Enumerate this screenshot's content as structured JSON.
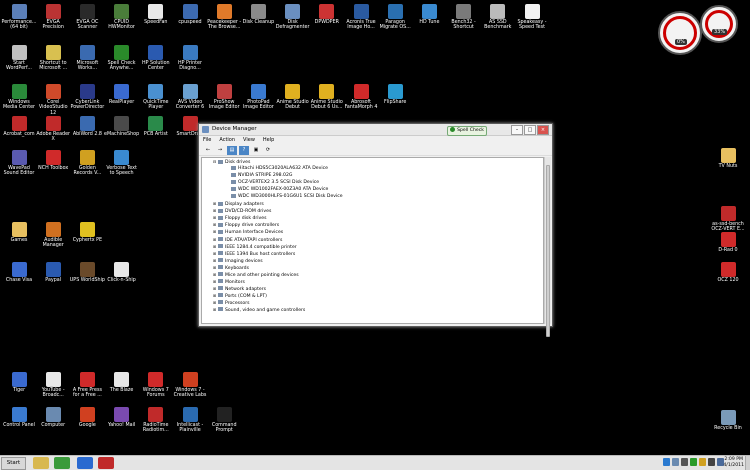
{
  "desktop": {
    "icons": [
      {
        "label": "Performance... (64 bit)",
        "color": "#5b7fb8"
      },
      {
        "label": "EVGA Precision",
        "color": "#b33"
      },
      {
        "label": "EVGA OC Scanner",
        "color": "#2a2a2a"
      },
      {
        "label": "CPUID HWMonitor",
        "color": "#4a7d3a"
      },
      {
        "label": "SpeedFan",
        "color": "#e8e8e8"
      },
      {
        "label": "cpuspeed",
        "color": "#3c6ab0"
      },
      {
        "label": "Peacekeeper - The Browse...",
        "color": "#e07a2a"
      },
      {
        "label": "Disk Cleanup",
        "color": "#8a8a8a"
      },
      {
        "label": "Disk Defragmenter",
        "color": "#6a8fc0"
      },
      {
        "label": "DPWDPER",
        "color": "#c33"
      },
      {
        "label": "Acronis True Image Ho...",
        "color": "#2a5aa0"
      },
      {
        "label": "Paragon Migrate OS...",
        "color": "#2a6fb0"
      },
      {
        "label": "HD Tune",
        "color": "#3a8ad0"
      },
      {
        "label": "Bench32 - Shortcut",
        "color": "#7a7a7a"
      },
      {
        "label": "AS SSD Benchmark",
        "color": "#bbb"
      },
      {
        "label": "Speakeasy - Speed Test",
        "color": "#f2f2f2"
      },
      {
        "label": "Start WordPerf...",
        "color": "#c0c0c0"
      },
      {
        "label": "Shortcut to Microsoft ...",
        "color": "#d8c050"
      },
      {
        "label": "Microsoft Works...",
        "color": "#3a6ab0"
      },
      {
        "label": "Spell Check Anywhe...",
        "color": "#2a8a2a"
      },
      {
        "label": "HP Solution Center",
        "color": "#2a5ab0"
      },
      {
        "label": "HP Printer Diagno...",
        "color": "#3a7ac0"
      },
      {
        "label": "Windows Media Center",
        "color": "#2a8a3a"
      },
      {
        "label": "Corel VideoStudio 12",
        "color": "#d04a2a"
      },
      {
        "label": "CyberLink PowerDirector",
        "color": "#2a3a8a"
      },
      {
        "label": "RealPlayer",
        "color": "#3a6ad0"
      },
      {
        "label": "QuickTime Player",
        "color": "#4a90d0"
      },
      {
        "label": "AVS Video Converter 6",
        "color": "#6aa0d0"
      },
      {
        "label": "ProShow Image Editor",
        "color": "#c04040"
      },
      {
        "label": "PhotoPad Image Editor",
        "color": "#3a7ad0"
      },
      {
        "label": "Anime Studio Debut",
        "color": "#e0b020"
      },
      {
        "label": "Anime Studio Debut 6 Us...",
        "color": "#e0b020"
      },
      {
        "label": "Abrosoft FantaMorph 4",
        "color": "#d02a2a"
      },
      {
        "label": "FlipShare",
        "color": "#2a9ad0"
      },
      {
        "label": "Acrobat_com",
        "color": "#c02a2a"
      },
      {
        "label": "Adobe Reader X",
        "color": "#c02a2a"
      },
      {
        "label": "AbiWord 2.8",
        "color": "#3a6ab0"
      },
      {
        "label": "eMachineShop",
        "color": "#4a4a4a"
      },
      {
        "label": "PCB Artist",
        "color": "#2a8a4a"
      },
      {
        "label": "SmartDraw",
        "color": "#c02a2a"
      },
      {
        "label": "WavePad Sound Editor",
        "color": "#5a5ab0"
      },
      {
        "label": "NCH Toolbox",
        "color": "#d02a2a"
      },
      {
        "label": "Golden Records V...",
        "color": "#d0a020"
      },
      {
        "label": "Verbose Text to Speech",
        "color": "#3a8ad0"
      },
      {
        "label": "Games",
        "color": "#e8c060"
      },
      {
        "label": "Audible Manager",
        "color": "#d07020"
      },
      {
        "label": "Cyphertx PE",
        "color": "#e0c020"
      },
      {
        "label": "Chase Visa",
        "color": "#3a6ad0"
      },
      {
        "label": "Paypal",
        "color": "#2a5ab0"
      },
      {
        "label": "UPS WorldShip",
        "color": "#6a4a2a"
      },
      {
        "label": "Click-n-Ship",
        "color": "#e8e8e8"
      },
      {
        "label": "Tiger",
        "color": "#3a6ad0"
      },
      {
        "label": "YouTube - Broadc...",
        "color": "#e8e8e8"
      },
      {
        "label": "A Free Press for a Free ...",
        "color": "#d02a2a"
      },
      {
        "label": "The Blaze",
        "color": "#e8e8e8"
      },
      {
        "label": "Windows 7 Forums",
        "color": "#d02a2a"
      },
      {
        "label": "Windows 7 - Creative Labs",
        "color": "#d04020"
      },
      {
        "label": "Control Panel",
        "color": "#3a7ad0"
      },
      {
        "label": "Computer",
        "color": "#6a8ab0"
      },
      {
        "label": "Google",
        "color": "#d04020"
      },
      {
        "label": "Yahoo! Mail",
        "color": "#7a4ab0"
      },
      {
        "label": "RadioTime Radiotim...",
        "color": "#c02a2a"
      },
      {
        "label": "Intellicast - Plainville",
        "color": "#2a6ab0"
      },
      {
        "label": "Command Prompt",
        "color": "#222"
      },
      {
        "label": "TV Nuts",
        "color": "#e8c060"
      },
      {
        "label": "as-ssd-bench OCZ-VERT E...",
        "color": "#c02a2a"
      },
      {
        "label": "D-Rad 0",
        "color": "#d02a2a"
      },
      {
        "label": "OCZ 120",
        "color": "#d02a2a"
      },
      {
        "label": "Recycle Bin",
        "color": "#7a9ab8"
      }
    ]
  },
  "gadgets": {
    "cpu_meter_value": "0%",
    "ram_meter_value": "33%"
  },
  "spell_check": {
    "label": "Spell Check"
  },
  "device_manager": {
    "title": "Device Manager",
    "menu": [
      "File",
      "Action",
      "View",
      "Help"
    ],
    "toolbar": [
      "←",
      "→",
      "▤",
      "?",
      "▣",
      "⟳"
    ],
    "tree": [
      {
        "kind": "root",
        "expander": "⊟",
        "label": "Disk drives"
      },
      {
        "kind": "child",
        "expander": "",
        "label": "Hitachi HDS5C3020ALA632 ATA Device"
      },
      {
        "kind": "child",
        "expander": "",
        "label": "NVIDIA  STRIPE  298.02G"
      },
      {
        "kind": "child",
        "expander": "",
        "label": "OCZ-VERTEX2 3.5 SCSI Disk Device"
      },
      {
        "kind": "child",
        "expander": "",
        "label": "WDC WD1002FAEX-00Z3A0 ATA Device"
      },
      {
        "kind": "child",
        "expander": "",
        "label": "WDC WD3000HLFS-01G6U1 SCSI Disk Device"
      },
      {
        "kind": "cat",
        "expander": "⊞",
        "label": "Display adapters"
      },
      {
        "kind": "cat",
        "expander": "⊞",
        "label": "DVD/CD-ROM drives"
      },
      {
        "kind": "cat",
        "expander": "⊞",
        "label": "Floppy disk drives"
      },
      {
        "kind": "cat",
        "expander": "⊞",
        "label": "Floppy drive controllers"
      },
      {
        "kind": "cat",
        "expander": "⊞",
        "label": "Human Interface Devices"
      },
      {
        "kind": "cat",
        "expander": "⊞",
        "label": "IDE ATA/ATAPI controllers"
      },
      {
        "kind": "cat",
        "expander": "⊞",
        "label": "IEEE 1284.4 compatible printer"
      },
      {
        "kind": "cat",
        "expander": "⊞",
        "label": "IEEE 1394 Bus host controllers"
      },
      {
        "kind": "cat",
        "expander": "⊞",
        "label": "Imaging devices"
      },
      {
        "kind": "cat",
        "expander": "⊞",
        "label": "Keyboards"
      },
      {
        "kind": "cat",
        "expander": "⊞",
        "label": "Mice and other pointing devices"
      },
      {
        "kind": "cat",
        "expander": "⊞",
        "label": "Monitors"
      },
      {
        "kind": "cat",
        "expander": "⊞",
        "label": "Network adapters"
      },
      {
        "kind": "cat",
        "expander": "⊞",
        "label": "Ports (COM & LPT)"
      },
      {
        "kind": "cat",
        "expander": "⊞",
        "label": "Processors"
      },
      {
        "kind": "cat",
        "expander": "⊞",
        "label": "Sound, video and game controllers"
      }
    ]
  },
  "taskbar": {
    "start_label": "Start",
    "pinned": [
      {
        "name": "explorer-taskbar-button",
        "color": "#d8b850"
      },
      {
        "name": "chrome-taskbar-button",
        "color": "#3a9a3a"
      },
      {
        "name": "media-taskbar-button",
        "color": "#2a6ad0"
      },
      {
        "name": "toolbox-taskbar-button",
        "color": "#c02a2a"
      }
    ],
    "tray": [
      {
        "name": "tray-shield-icon",
        "color": "#2a7ad0"
      },
      {
        "name": "tray-network-icon",
        "color": "#6a8ab0"
      },
      {
        "name": "tray-volume-icon",
        "color": "#555"
      },
      {
        "name": "tray-green-icon",
        "color": "#2a9a2a"
      },
      {
        "name": "tray-flag-icon",
        "color": "#d0a020"
      },
      {
        "name": "tray-speaker-icon",
        "color": "#444"
      },
      {
        "name": "tray-monitor-icon",
        "color": "#4a6a9a"
      }
    ],
    "time": "2:09 PM",
    "date": "4/1/2011"
  }
}
